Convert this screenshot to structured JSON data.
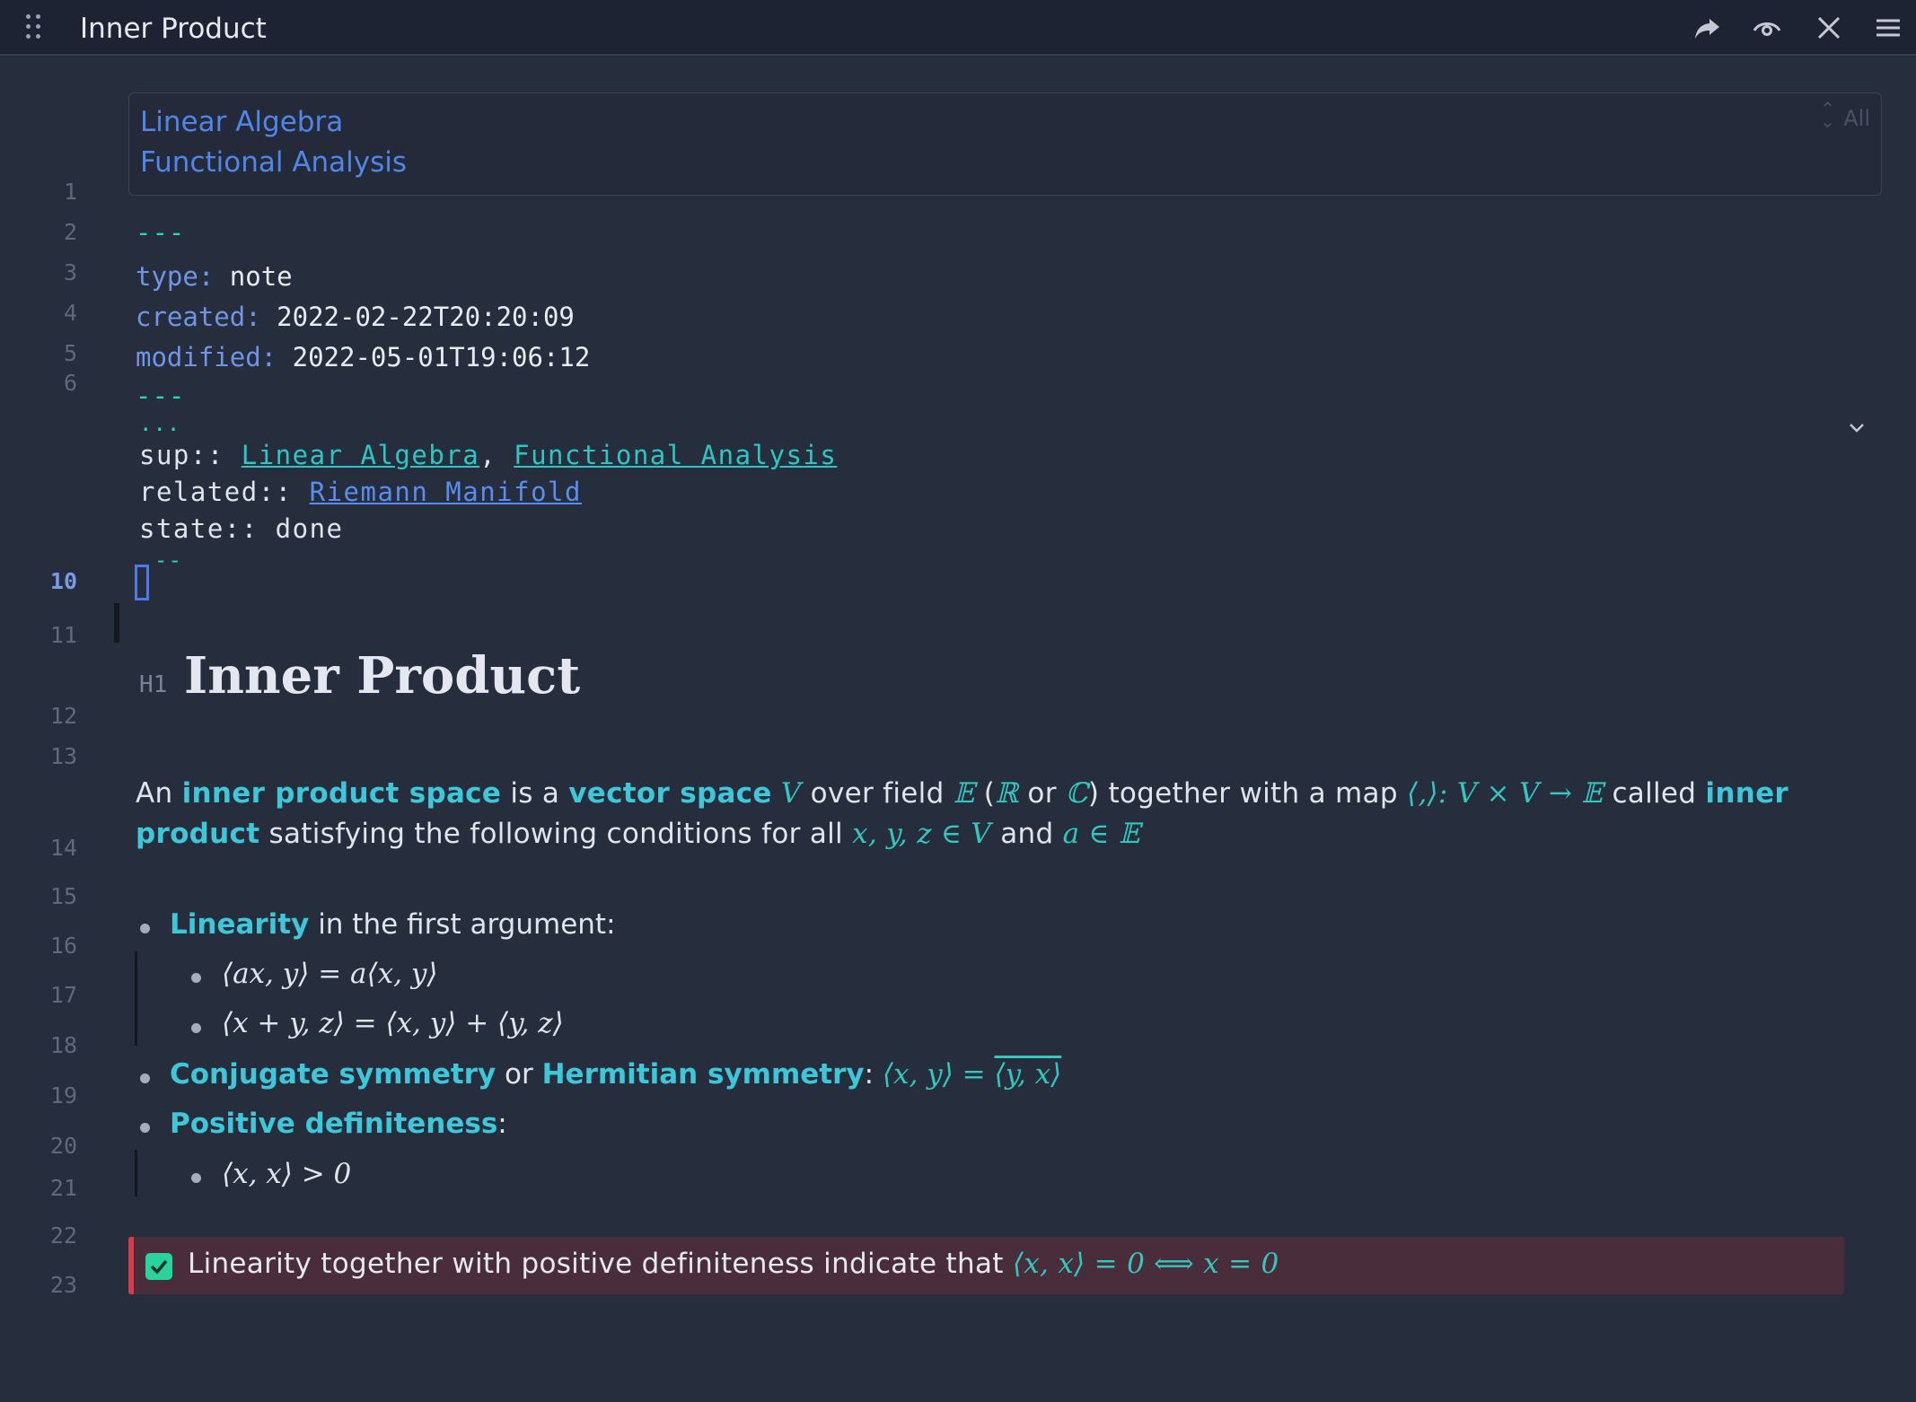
{
  "header": {
    "title": "Inner Product"
  },
  "tags": {
    "items": [
      "Linear Algebra",
      "Functional Analysis"
    ],
    "badge": "All"
  },
  "line_numbers": [
    "1",
    "2",
    "3",
    "4",
    "5",
    "6",
    "10",
    "11",
    "12",
    "13",
    "14",
    "15",
    "16",
    "17",
    "18",
    "19",
    "20",
    "21",
    "22",
    "23"
  ],
  "frontmatter": {
    "open": "---",
    "type_key": "type:",
    "type_val": "note",
    "created_key": "created:",
    "created_val": "2022-02-22T20:20:09",
    "modified_key": "modified:",
    "modified_val": "2022-05-01T19:06:12",
    "close": "---",
    "ellipsis": "...",
    "after_cursor": "--"
  },
  "properties": {
    "sup_key": "sup:: ",
    "sup_link1": "Linear Algebra",
    "sup_sep": ", ",
    "sup_link2": "Functional Analysis",
    "related_key": "related:: ",
    "related_link": "Riemann Manifold",
    "state": "state:: done"
  },
  "heading": {
    "level": "H1",
    "text": "Inner Product"
  },
  "paragraph": {
    "t1": "An ",
    "s1": "inner product space",
    "t2": " is a ",
    "s2": "vector space",
    "m1": " V ",
    "t3": "over field ",
    "m2": "𝔼",
    "t4": " (",
    "m3": "ℝ",
    "t5": " or ",
    "m4": "ℂ",
    "t6": ") together with a map ",
    "m5": "⟨,⟩: V × V → 𝔼",
    "t7": " called ",
    "s3": "inner product",
    "t8": " satisfying the following conditions for all ",
    "m6": "x, y, z ∈ V",
    "t9": " and ",
    "m7": "a ∈ 𝔼"
  },
  "list": {
    "linearity": "Linearity",
    "linearity_rest": " in the first argument:",
    "lin_eq1": "⟨ax, y⟩ = a⟨x, y⟩",
    "lin_eq2": "⟨x + y, z⟩ = ⟨x, y⟩ + ⟨y, z⟩",
    "conj": "Conjugate symmetry",
    "or": " or ",
    "herm": "Hermitian symmetry",
    "colon": ": ",
    "sym_eq_lhs": "⟨x, y⟩ = ",
    "sym_eq_rhs": "⟨y, x⟩",
    "posdef": "Positive definiteness",
    "posdef_colon": ":",
    "pos_eq": "⟨x, x⟩ > 0"
  },
  "callout": {
    "text": "Linearity together with positive definiteness indicate that ",
    "math": "⟨x, x⟩ = 0  ⟺  x = 0"
  },
  "colors": {
    "background": "#262d3c",
    "accent_teal": "#33c7bf",
    "accent_blue": "#4f86e8",
    "callout_bg": "#4a2d3a",
    "callout_border": "#d63b4b"
  },
  "icons": [
    "drag-handle-icon",
    "share-icon",
    "eye-icon",
    "close-icon",
    "menu-icon",
    "chevron-down-icon",
    "checkbox-icon"
  ]
}
